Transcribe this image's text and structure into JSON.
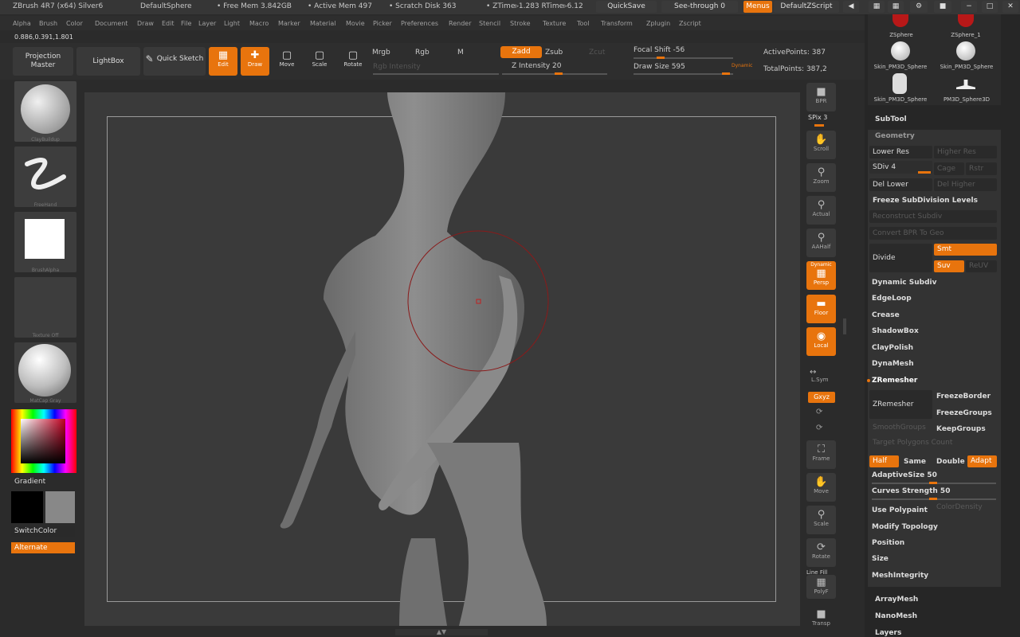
{
  "title_bar": {
    "app_title": "ZBrush 4R7 (x64) Silver6",
    "document": "DefaultSphere",
    "free_mem": "• Free Mem 3.842GB",
    "active_mem": "• Active Mem 497",
    "scratch_disk": "• Scratch Disk 363",
    "ztime": "• ZTime▹1.283 RTime▹6.12",
    "quicksave": "QuickSave",
    "see_through": "See-through  0",
    "menus": "Menus",
    "default_zscript": "DefaultZScript"
  },
  "menu_bar": [
    "Alpha",
    "Brush",
    "Color",
    "Document",
    "Draw",
    "Edit",
    "File",
    "Layer",
    "Light",
    "Macro",
    "Marker",
    "Material",
    "Movie",
    "Picker",
    "Preferences",
    "Render",
    "Stencil",
    "Stroke",
    "Texture",
    "Tool",
    "Transform",
    "Zplugin",
    "Zscript"
  ],
  "coords": "0.886,0.391,1.801",
  "toolbar": {
    "projection_master": "Projection Master",
    "lightbox": "LightBox",
    "quick_sketch": "Quick Sketch",
    "edit": "Edit",
    "draw": "Draw",
    "move": "Move",
    "scale": "Scale",
    "rotate": "Rotate",
    "mrgb": "Mrgb",
    "rgb": "Rgb",
    "m": "M",
    "rgb_intensity": "Rgb Intensity",
    "zadd": "Zadd",
    "zsub": "Zsub",
    "zcut": "Zcut",
    "z_intensity": "Z Intensity 20",
    "focal_shift": "Focal Shift -56",
    "draw_size": "Draw Size 595",
    "dynamic": "Dynamic",
    "active_points": "ActivePoints: 387",
    "total_points": "TotalPoints: 387,2"
  },
  "left_shelf": {
    "brush_label": "ClayBuildup",
    "stroke_label": "FreeHand",
    "alpha_label": "BrushAlpha",
    "texture_label": "Texture Off",
    "material_label": "MatCap Gray",
    "gradient": "Gradient",
    "switch_color": "SwitchColor",
    "alternate": "Alternate"
  },
  "right_shelf": {
    "bpr": "BPR",
    "spix": "SPix 3",
    "scroll": "Scroll",
    "zoom": "Zoom",
    "actual": "Actual",
    "aahalf": "AAHalf",
    "dynamic": "Dynamic",
    "persp": "Persp",
    "floor": "Floor",
    "local": "Local",
    "lsym": "L.Sym",
    "xyz": "Gxyz",
    "frame": "Frame",
    "move": "Move",
    "scale": "Scale",
    "rotate": "Rotate",
    "linefill": "Line Fill",
    "polyf": "PolyF",
    "transp": "Transp"
  },
  "tool_palette": {
    "items": [
      "ZSphere",
      "ZSphere_1",
      "Skin_PM3D_Sphere",
      "Skin_PM3D_Sphere",
      "Skin_PM3D_Sphere",
      "PM3D_Sphere3D"
    ]
  },
  "subtool": {
    "subtool": "SubTool",
    "geometry": "Geometry",
    "lower_res": "Lower Res",
    "higher_res": "Higher Res",
    "sdiv": "SDiv 4",
    "cage": "Cage",
    "rstr": "Rstr",
    "del_lower": "Del Lower",
    "del_higher": "Del Higher",
    "freeze_subdiv": "Freeze SubDivision Levels",
    "reconstruct": "Reconstruct Subdiv",
    "convert": "Convert BPR To Geo",
    "divide": "Divide",
    "smt": "Smt",
    "suv": "Suv",
    "reuv": "ReUV",
    "dynamic_subdiv": "Dynamic Subdiv",
    "edgeloop": "EdgeLoop",
    "crease": "Crease",
    "shadowbox": "ShadowBox",
    "claypolish": "ClayPolish",
    "dynamesh": "DynaMesh",
    "zremesher_header": "ZRemesher",
    "zremesher": "ZRemesher",
    "freeze_border": "FreezeBorder",
    "freeze_groups": "FreezeGroups",
    "smooth_groups": "SmoothGroups",
    "keep_groups": "KeepGroups",
    "target_polygons": "Target Polygons Count",
    "half": "Half",
    "same": "Same",
    "double": "Double",
    "adapt": "Adapt",
    "adaptive_size": "AdaptiveSize 50",
    "curves_strength": "Curves Strength 50",
    "use_polypaint": "Use Polypaint",
    "color_density": "ColorDensity",
    "modify_topology": "Modify Topology",
    "position": "Position",
    "size": "Size",
    "mesh_integrity": "MeshIntegrity",
    "array_mesh": "ArrayMesh",
    "nano_mesh": "NanoMesh",
    "layers": "Layers"
  },
  "colors": {
    "accent": "#e8740d",
    "bg": "#2b2b2b",
    "viewport": "#3a3a3a"
  }
}
